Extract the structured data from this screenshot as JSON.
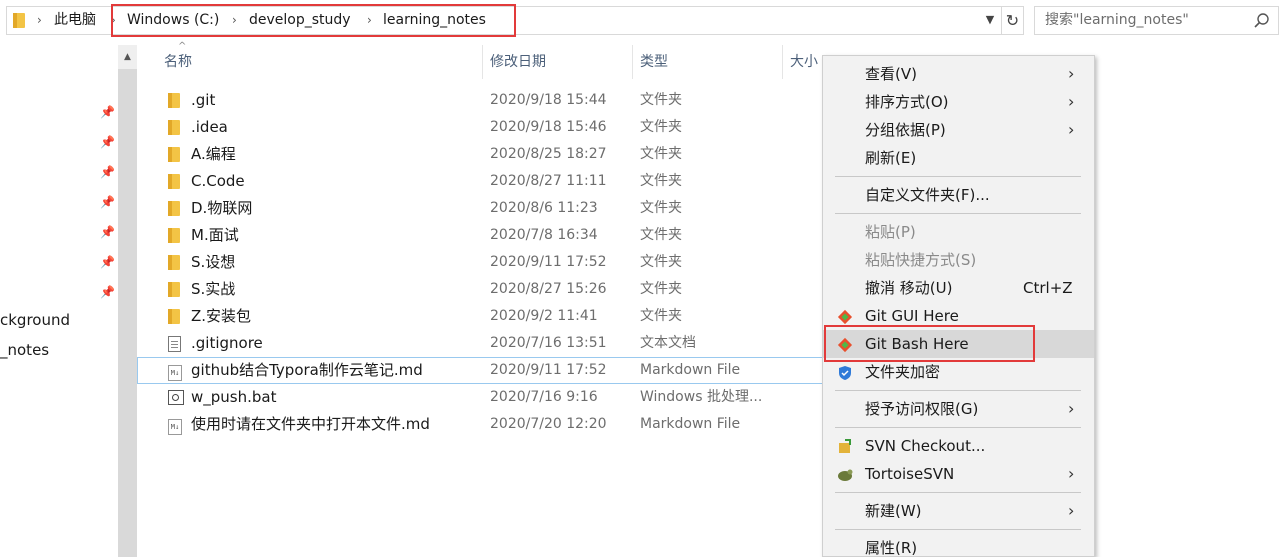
{
  "address": {
    "path": [
      "此电脑",
      "Windows (C:)",
      "develop_study",
      "learning_notes"
    ],
    "search_placeholder": "搜索\"learning_notes\""
  },
  "nav": {
    "labels": [
      "ckground",
      "_notes"
    ]
  },
  "columns": [
    "名称",
    "修改日期",
    "类型",
    "大小"
  ],
  "files": [
    {
      "name": ".git",
      "date": "2020/9/18 15:44",
      "type": "文件夹",
      "icon": "folder-icon"
    },
    {
      "name": ".idea",
      "date": "2020/9/18 15:46",
      "type": "文件夹",
      "icon": "folder-icon"
    },
    {
      "name": "A.编程",
      "date": "2020/8/25 18:27",
      "type": "文件夹",
      "icon": "folder-icon"
    },
    {
      "name": "C.Code",
      "date": "2020/8/27 11:11",
      "type": "文件夹",
      "icon": "folder-icon"
    },
    {
      "name": "D.物联网",
      "date": "2020/8/6 11:23",
      "type": "文件夹",
      "icon": "folder-icon"
    },
    {
      "name": "M.面试",
      "date": "2020/7/8 16:34",
      "type": "文件夹",
      "icon": "folder-icon"
    },
    {
      "name": "S.设想",
      "date": "2020/9/11 17:52",
      "type": "文件夹",
      "icon": "folder-icon"
    },
    {
      "name": "S.实战",
      "date": "2020/8/27 15:26",
      "type": "文件夹",
      "icon": "folder-icon"
    },
    {
      "name": "Z.安装包",
      "date": "2020/9/2 11:41",
      "type": "文件夹",
      "icon": "folder-icon"
    },
    {
      "name": ".gitignore",
      "date": "2020/7/16 13:51",
      "type": "文本文档",
      "icon": "text-file-icon"
    },
    {
      "name": "github结合Typora制作云笔记.md",
      "date": "2020/9/11 17:52",
      "type": "Markdown File",
      "icon": "markdown-file-icon"
    },
    {
      "name": "w_push.bat",
      "date": "2020/7/16 9:16",
      "type": "Windows 批处理...",
      "icon": "batch-file-icon"
    },
    {
      "name": "使用时请在文件夹中打开本文件.md",
      "date": "2020/7/20 12:20",
      "type": "Markdown File",
      "icon": "markdown-file-icon"
    }
  ],
  "context_menu": {
    "view": "查看(V)",
    "sort": "排序方式(O)",
    "group": "分组依据(P)",
    "refresh": "刷新(E)",
    "customize": "自定义文件夹(F)...",
    "paste": "粘贴(P)",
    "paste_shortcut": "粘贴快捷方式(S)",
    "undo": "撤消 移动(U)",
    "undo_shortcut": "Ctrl+Z",
    "git_gui": "Git GUI Here",
    "git_bash": "Git Bash Here",
    "encrypt": "文件夹加密",
    "grant_access": "授予访问权限(G)",
    "svn_checkout": "SVN Checkout...",
    "tortoise_svn": "TortoiseSVN",
    "new": "新建(W)",
    "properties": "属性(R)"
  },
  "colors": {
    "highlight_border": "#e23a3a",
    "folder": "#f3c445",
    "menu_bg": "#f2f2f2"
  }
}
